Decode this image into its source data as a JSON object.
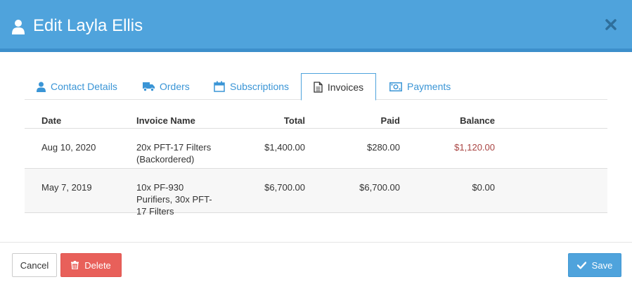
{
  "modal": {
    "title": "Edit Layla Ellis",
    "icon": "user-icon",
    "close_icon": "close-icon"
  },
  "tabs": [
    {
      "label": "Contact Details",
      "icon": "user-icon",
      "active": false
    },
    {
      "label": "Orders",
      "icon": "truck-icon",
      "active": false
    },
    {
      "label": "Subscriptions",
      "icon": "calendar-icon",
      "active": false
    },
    {
      "label": "Invoices",
      "icon": "document-icon",
      "active": true
    },
    {
      "label": "Payments",
      "icon": "money-icon",
      "active": false
    }
  ],
  "table": {
    "headers": [
      "Date",
      "Invoice Name",
      "Total",
      "Paid",
      "Balance"
    ],
    "rows": [
      {
        "date": "Aug 10, 2020",
        "name": "20x PFT-17 Filters (Backordered)",
        "total": "$1,400.00",
        "paid": "$280.00",
        "balance": "$1,120.00"
      },
      {
        "date": "May 7, 2019",
        "name": "10x PF-930 Purifiers, 30x PFT-17 Filters",
        "total": "$6,700.00",
        "paid": "$6,700.00",
        "balance": "$0.00"
      }
    ]
  },
  "footer": {
    "cancel_label": "Cancel",
    "delete_label": "Delete",
    "save_label": "Save"
  },
  "colors": {
    "header": "#4fa3dc",
    "accent": "#3a95d6",
    "danger": "#e8605a",
    "negative_balance": "#a94442"
  }
}
